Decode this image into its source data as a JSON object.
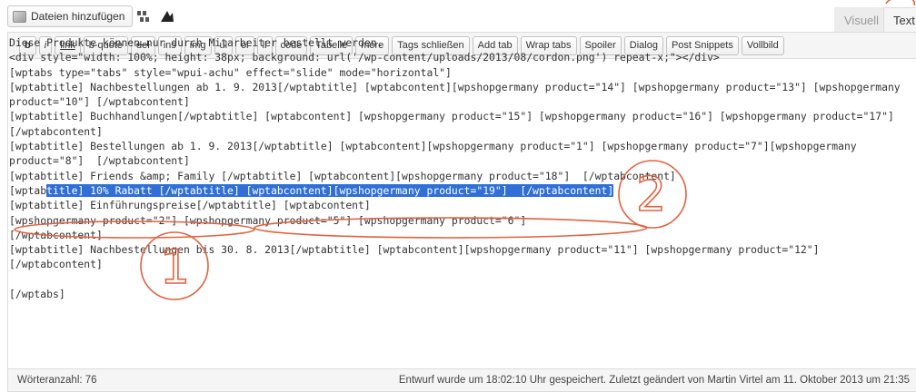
{
  "media": {
    "add_label": "Dateien hinzufügen"
  },
  "mode_tabs": {
    "visual": "Visuell",
    "text": "Text"
  },
  "toolbar": [
    {
      "label": "b",
      "style": "bold"
    },
    {
      "label": "i",
      "style": "ital"
    },
    {
      "label": "link",
      "style": "link"
    },
    {
      "label": "b-quote",
      "style": ""
    },
    {
      "label": "del",
      "style": "strike"
    },
    {
      "label": "ins",
      "style": ""
    },
    {
      "label": "img",
      "style": ""
    },
    {
      "label": "ul",
      "style": ""
    },
    {
      "label": "ol",
      "style": ""
    },
    {
      "label": "li",
      "style": ""
    },
    {
      "label": "code",
      "style": ""
    },
    {
      "label": "Tabelle",
      "style": ""
    },
    {
      "label": "more",
      "style": ""
    },
    {
      "label": "Tags schließen",
      "style": ""
    },
    {
      "label": "Add tab",
      "style": ""
    },
    {
      "label": "Wrap tabs",
      "style": ""
    },
    {
      "label": "Spoiler",
      "style": ""
    },
    {
      "label": "Dialog",
      "style": ""
    },
    {
      "label": "Post Snippets",
      "style": ""
    },
    {
      "label": "Vollbild",
      "style": ""
    }
  ],
  "editor_lines": [
    {
      "segments": [
        {
          "text": "Diese Produkte können nur durch Mitarbeiter bestellt werden."
        }
      ]
    },
    {
      "segments": [
        {
          "text": "<div style=\"width: 100%; height: 38px; background: url('/wp-content/uploads/2013/08/cordon.png') repeat-x;\"></div>"
        }
      ]
    },
    {
      "segments": [
        {
          "text": "[wptabs type=\"tabs\" style=\"wpui-achu\" effect=\"slide\" mode=\"horizontal\"]"
        }
      ]
    },
    {
      "segments": [
        {
          "text": "[wptabtitle] Nachbestellungen ab 1. 9. 2013[/wptabtitle] [wptabcontent][wpshopgermany product=\"14\"] [wpshopgermany product=\"13\"] [wpshopgermany"
        }
      ]
    },
    {
      "segments": [
        {
          "text": "product=\"10\"] [/wptabcontent]"
        }
      ]
    },
    {
      "segments": [
        {
          "text": "[wptabtitle] Buchhandlungen[/wptabtitle] [wptabcontent] [wpshopgermany product=\"15\"] [wpshopgermany product=\"16\"] [wpshopgermany product=\"17\"]"
        }
      ]
    },
    {
      "segments": [
        {
          "text": "[/wptabcontent]"
        }
      ]
    },
    {
      "segments": [
        {
          "text": "[wptabtitle] Bestellungen ab 1. 9. 2013[/wptabtitle] [wptabcontent][wpshopgermany product=\"1\"] [wpshopgermany product=\"7\"][wpshopgermany"
        }
      ]
    },
    {
      "segments": [
        {
          "text": "product=\"8\"]  [/wptabcontent]"
        }
      ]
    },
    {
      "segments": [
        {
          "text": "[wptabtitle] Friends &amp; Family [/wptabtitle] [wptabcontent][wpshopgermany product=\"18\"]  [/wptabcontent]"
        }
      ]
    },
    {
      "segments": [
        {
          "text": "[wptab"
        },
        {
          "text": "title] 10% Rabatt [/wptabtitle] [wptabcontent][wpshopgermany product=\"19\"]  [/wptabcontent]",
          "selected": true
        }
      ]
    },
    {
      "segments": [
        {
          "text": "[wptabtitle] Einführungspreise[/wptabtitle] [wptabcontent]"
        }
      ]
    },
    {
      "segments": [
        {
          "text": "[wpshopgermany product=\"2\"] [wpshopgermany product=\"5\"] [wpshopgermany product=\"6\"]"
        }
      ]
    },
    {
      "segments": [
        {
          "text": "[/wptabcontent]"
        }
      ]
    },
    {
      "segments": [
        {
          "text": "[wptabtitle] Nachbestellungen bis 30. 8. 2013[/wptabtitle] [wptabcontent][wpshopgermany product=\"11\"] [wpshopgermany product=\"12\"]"
        }
      ]
    },
    {
      "segments": [
        {
          "text": "[/wptabcontent]"
        }
      ]
    },
    {
      "segments": [
        {
          "text": ""
        }
      ]
    },
    {
      "segments": [
        {
          "text": "[/wptabs]"
        }
      ]
    }
  ],
  "annotations": {
    "label_1": "1",
    "label_2": "2",
    "color": "#e0623f"
  },
  "status": {
    "word_count": "Wörteranzahl: 76",
    "saved_info": "Entwurf wurde um 18:02:10 Uhr gespeichert. Zuletzt geändert von Martin Virtel am 11. Oktober 2013 um 21:35"
  }
}
